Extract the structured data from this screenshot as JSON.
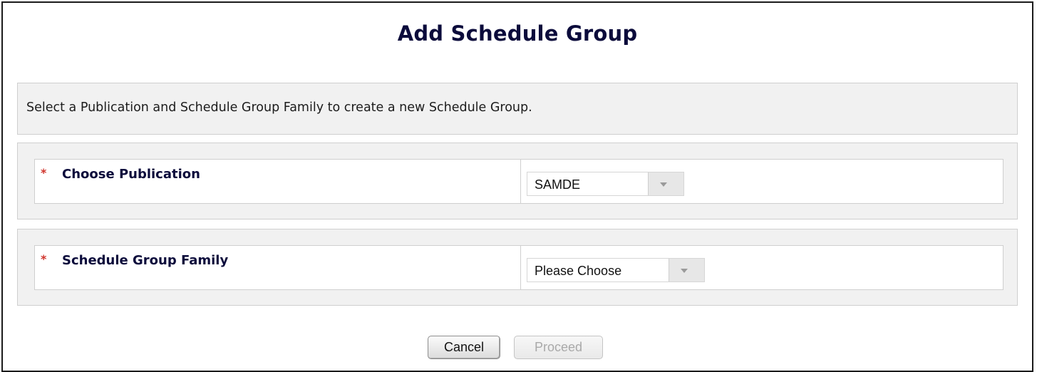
{
  "page": {
    "title": "Add Schedule Group",
    "instructions": "Select a Publication and Schedule Group Family to create a new Schedule Group."
  },
  "fields": {
    "publication": {
      "required_marker": "*",
      "label": "Choose Publication",
      "selected_value": "SAMDE"
    },
    "schedule_group_family": {
      "required_marker": "*",
      "label": "Schedule Group Family",
      "selected_value": "Please Choose"
    }
  },
  "actions": {
    "cancel_label": "Cancel",
    "proceed_label": "Proceed",
    "proceed_enabled": false
  },
  "icons": {
    "dropdown_arrow": "chevron-down-icon"
  },
  "colors": {
    "title_text": "#0b0b3b",
    "required_marker": "#d0342c",
    "panel_background": "#f1f1f1",
    "disabled_text": "#a9a9a9"
  }
}
